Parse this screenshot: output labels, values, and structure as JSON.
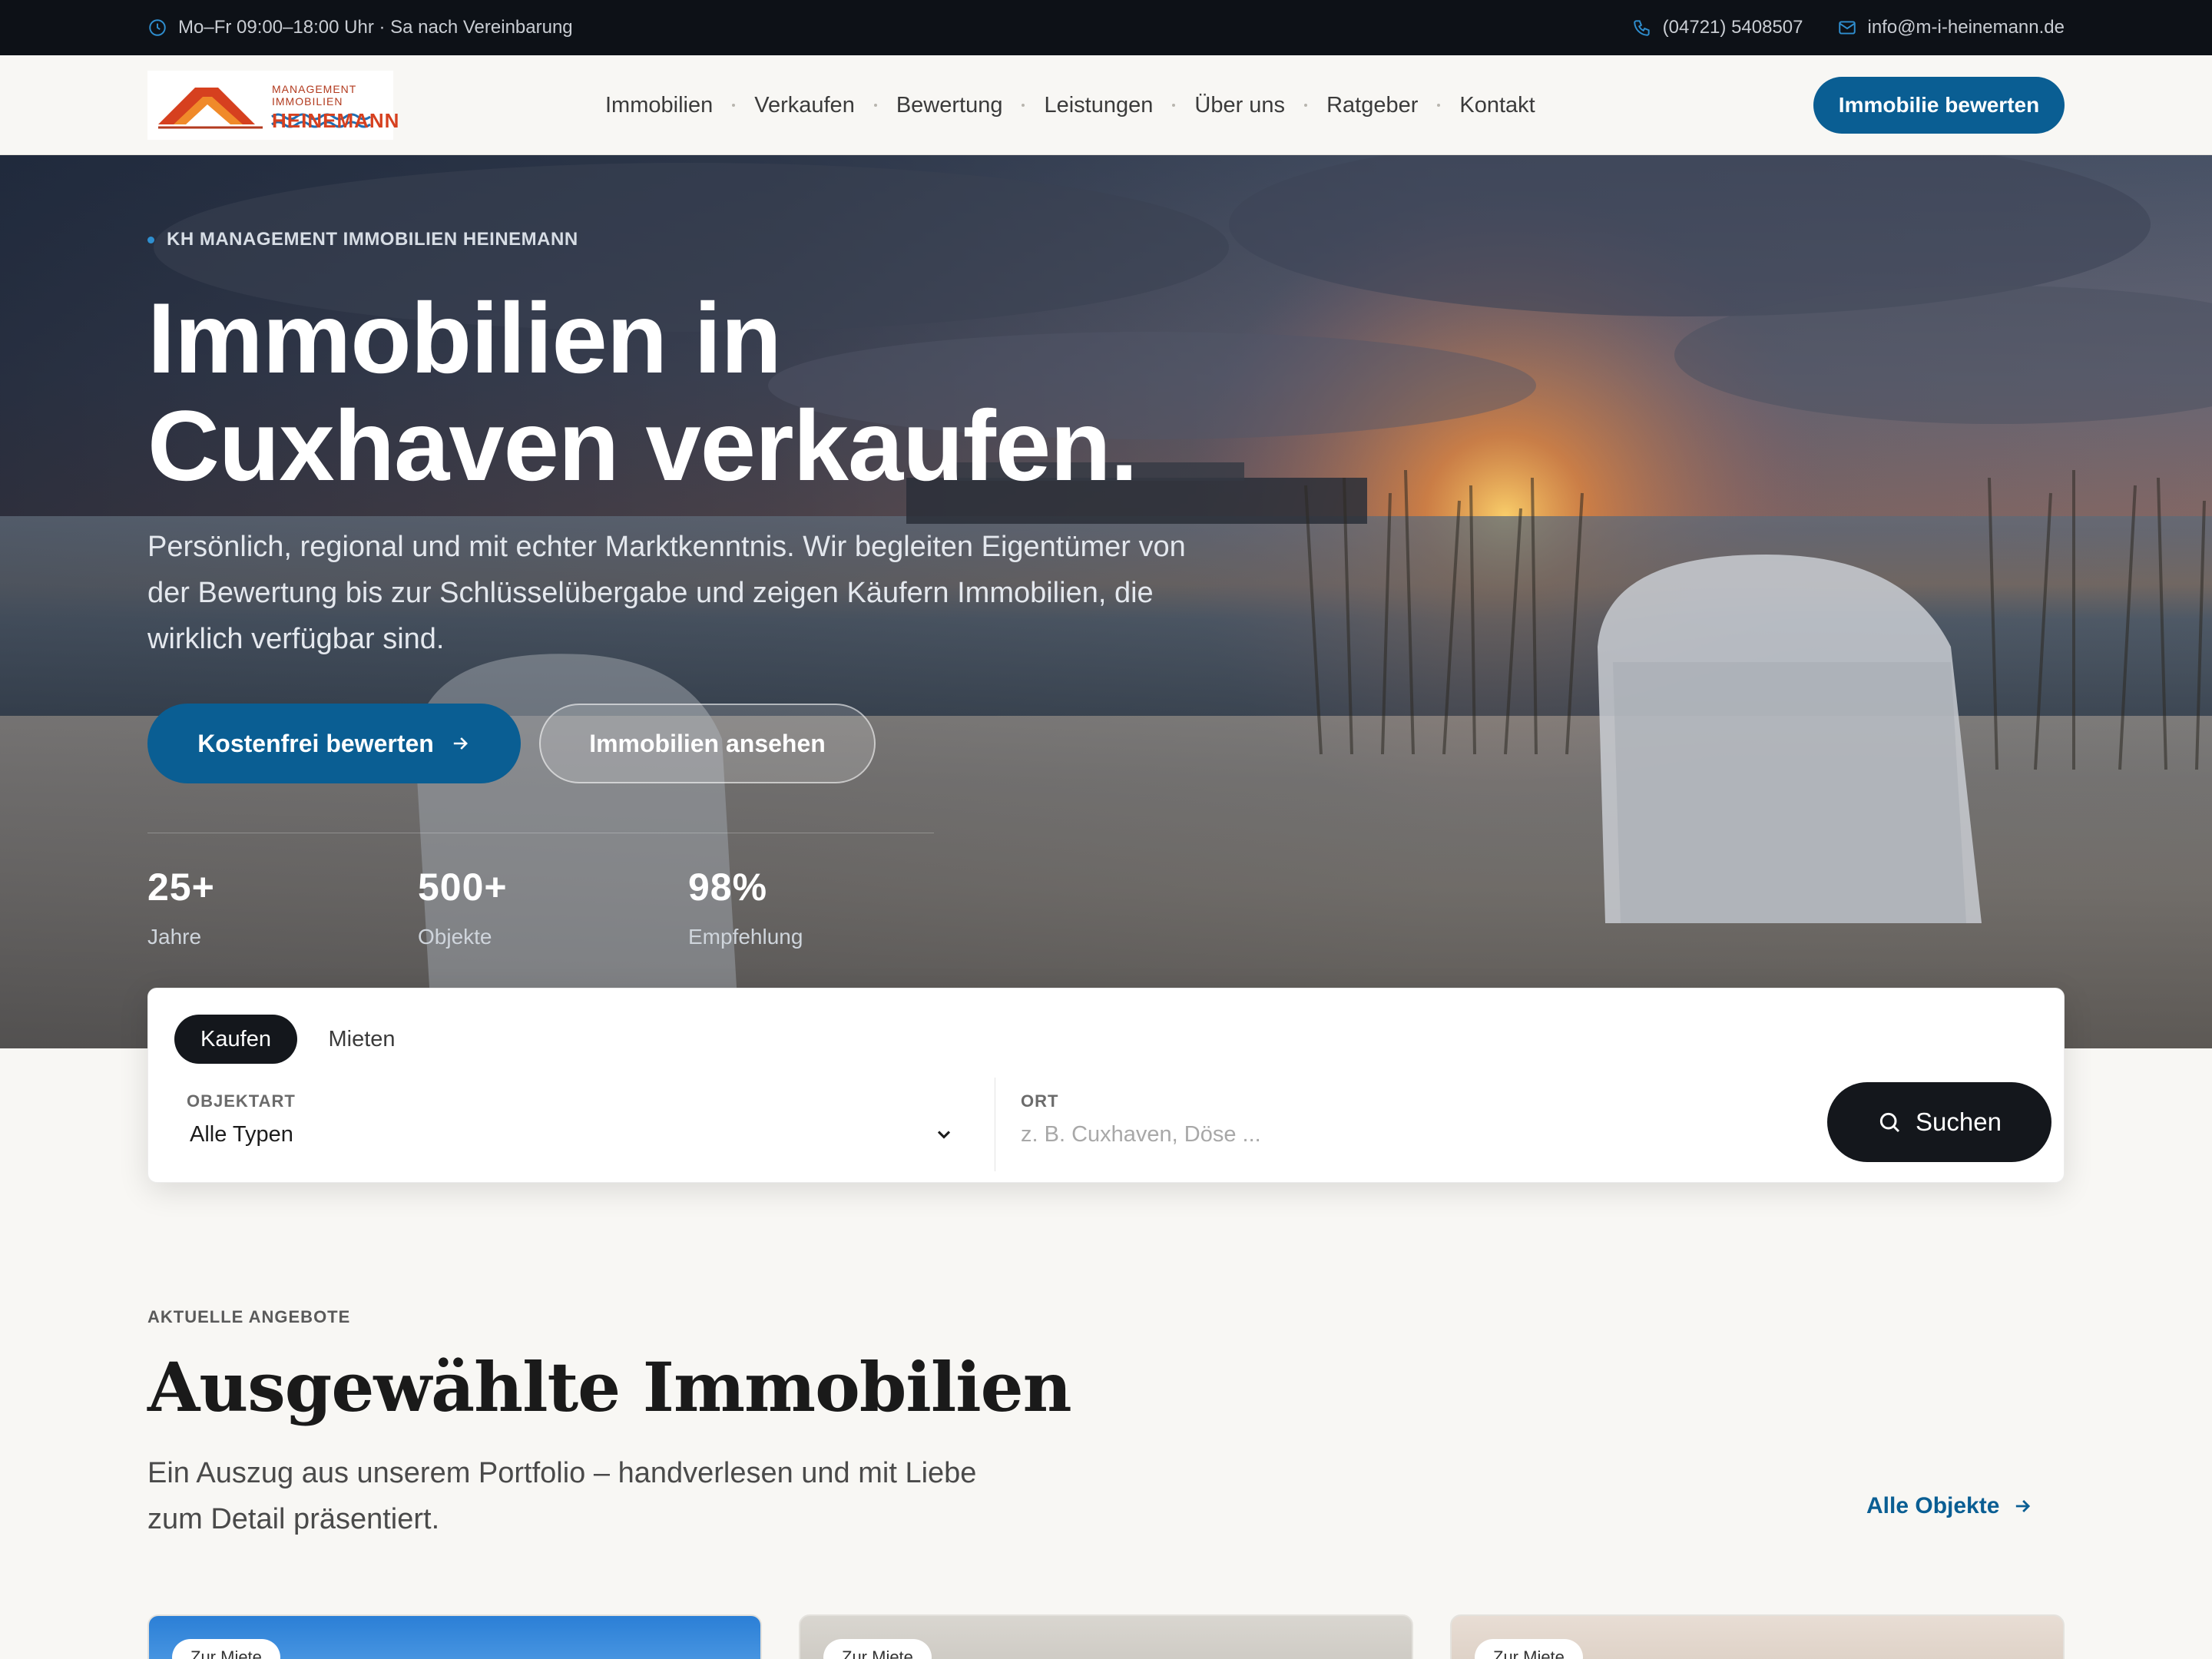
{
  "topbar": {
    "hours": "Mo–Fr 09:00–18:00 Uhr · Sa nach Vereinbarung",
    "phone": "(04721) 5408507",
    "email": "info@m-i-heinemann.de"
  },
  "logo": {
    "line1": "MANAGEMENT IMMOBILIEN",
    "line2": "HEINEMANN"
  },
  "nav": {
    "items": [
      "Immobilien",
      "Verkaufen",
      "Bewertung",
      "Leistungen",
      "Über uns",
      "Ratgeber",
      "Kontakt"
    ],
    "cta": "Immobilie bewerten"
  },
  "hero": {
    "eyebrow": "KH MANAGEMENT IMMOBILIEN HEINEMANN",
    "title_line1": "Immobilien in",
    "title_line2": "Cuxhaven verkaufen.",
    "lead": "Persönlich, regional und mit echter Marktkenntnis. Wir begleiten Eigentümer von der Bewertung bis zur Schlüsselübergabe und zeigen Käufern Immobilien, die wirklich verfügbar sind.",
    "primary_cta": "Kostenfrei bewerten",
    "secondary_cta": "Immobilien ansehen",
    "stats": [
      {
        "value": "25+",
        "label": "Jahre"
      },
      {
        "value": "500+",
        "label": "Objekte"
      },
      {
        "value": "98%",
        "label": "Empfehlung"
      }
    ]
  },
  "search": {
    "tabs": [
      "Kaufen",
      "Mieten"
    ],
    "active_tab": "Kaufen",
    "type_label": "OBJEKTART",
    "type_value": "Alle Typen",
    "location_label": "ORT",
    "location_placeholder": "z. B. Cuxhaven, Döse ...",
    "button": "Suchen"
  },
  "featured": {
    "eyebrow": "AKTUELLE ANGEBOTE",
    "title": "Ausgewählte Immobilien",
    "subtitle": "Ein Auszug aus unserem Portfolio – handverlesen und mit Liebe zum Detail präsentiert.",
    "all_link": "Alle Objekte",
    "cards": [
      {
        "badge": "Zur Miete"
      },
      {
        "badge": "Zur Miete"
      },
      {
        "badge": "Zur Miete"
      }
    ]
  },
  "colors": {
    "brand_blue": "#0a5e93",
    "dark": "#14171c",
    "topbar": "#0d1117",
    "logo_orange": "#d6401f"
  }
}
